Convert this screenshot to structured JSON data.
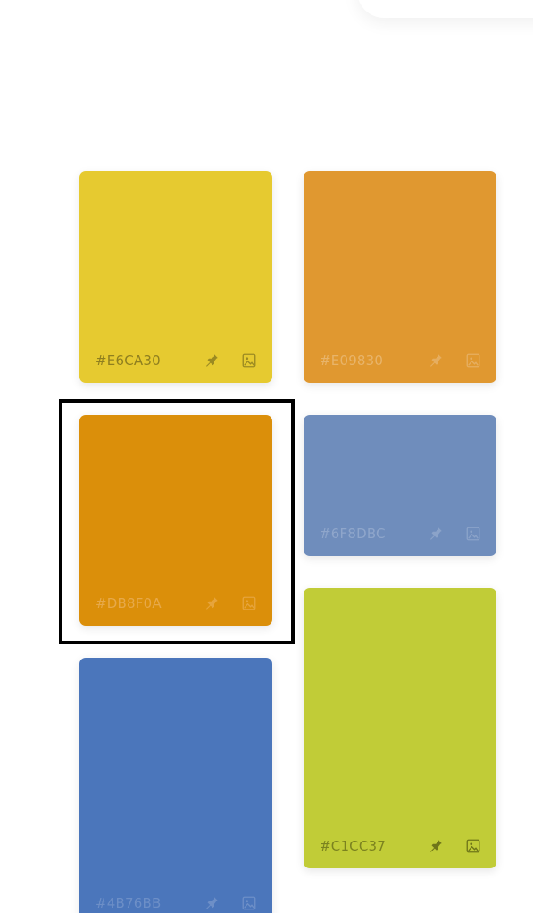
{
  "swatches": [
    {
      "hex": "#E6CA30",
      "color": "#E6CA30",
      "text_color": "#8f7f1f",
      "icon_color": "#9b8a22"
    },
    {
      "hex": "#E09830",
      "color": "#E09830",
      "text_color": "#e8b46a",
      "icon_color": "#e6ae60"
    },
    {
      "hex": "#DB8F0A",
      "color": "#DB8F0A",
      "text_color": "#e7a94a",
      "icon_color": "#e6a43c"
    },
    {
      "hex": "#6F8DBC",
      "color": "#6F8DBC",
      "text_color": "#8fa6cb",
      "icon_color": "#8ba3c9"
    },
    {
      "hex": "#4B76BB",
      "color": "#4B76BB",
      "text_color": "#6d8fc7",
      "icon_color": "#6d8fc7"
    },
    {
      "hex": "#C1CC37",
      "color": "#C1CC37",
      "text_color": "#7b821f",
      "icon_color": "#6f7519"
    }
  ],
  "selection": {
    "selected_swatch": "#DB8F0A",
    "border_color": "#000000"
  }
}
